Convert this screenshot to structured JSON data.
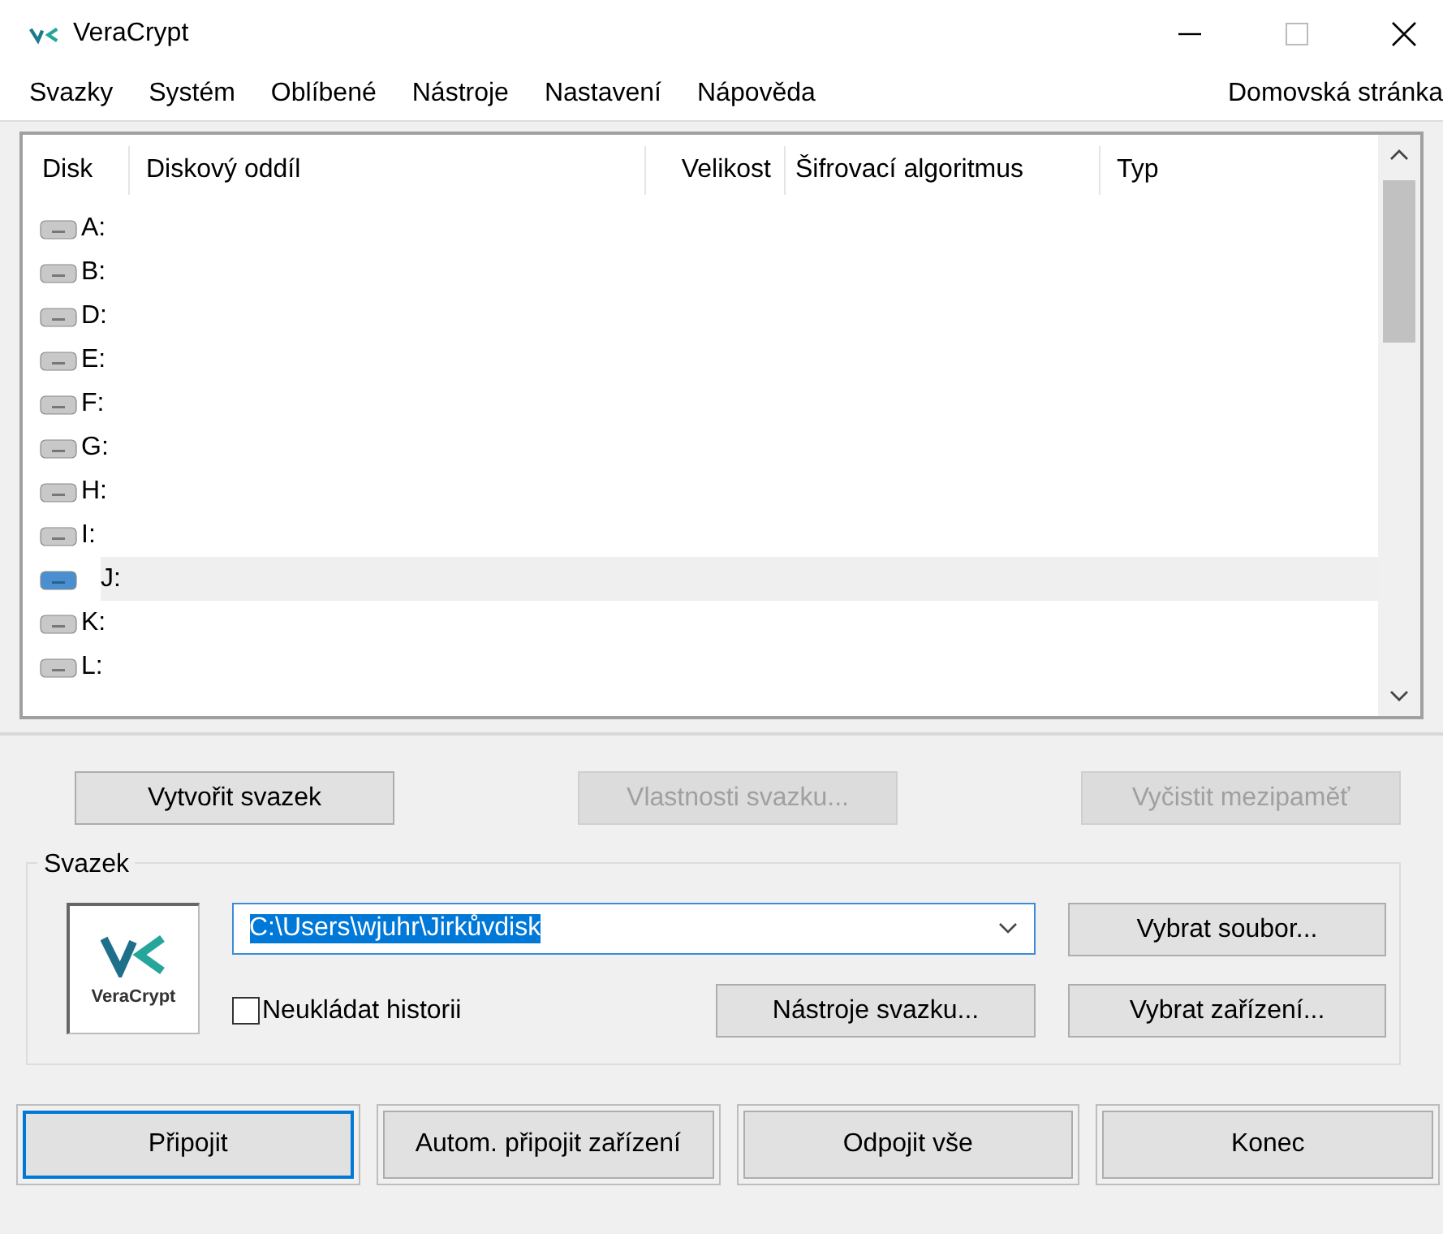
{
  "window": {
    "title": "VeraCrypt"
  },
  "menu": [
    "Svazky",
    "Systém",
    "Oblíbené",
    "Nástroje",
    "Nastavení",
    "Nápověda"
  ],
  "home_link": "Domovská stránka",
  "table": {
    "columns": [
      "Disk",
      "Diskový oddíl",
      "Velikost",
      "Šifrovací algoritmus",
      "Typ"
    ],
    "rows": [
      {
        "disk": "A:",
        "selected": false
      },
      {
        "disk": "B:",
        "selected": false
      },
      {
        "disk": "D:",
        "selected": false
      },
      {
        "disk": "E:",
        "selected": false
      },
      {
        "disk": "F:",
        "selected": false
      },
      {
        "disk": "G:",
        "selected": false
      },
      {
        "disk": "H:",
        "selected": false
      },
      {
        "disk": "I:",
        "selected": false
      },
      {
        "disk": "J:",
        "selected": true
      },
      {
        "disk": "K:",
        "selected": false
      },
      {
        "disk": "L:",
        "selected": false
      }
    ]
  },
  "top_buttons": [
    {
      "label": "Vytvořit svazek",
      "disabled": false
    },
    {
      "label": "Vlastnosti svazku...",
      "disabled": true
    },
    {
      "label": "Vyčistit mezipaměť",
      "disabled": true
    }
  ],
  "volume": {
    "label": "Svazek",
    "logo_text": "VeraCrypt",
    "path": "C:\\Users\\wjuhr\\Jirkůvdisk",
    "no_history": {
      "label": "Neukládat historii",
      "checked": false
    },
    "select_file": "Vybrat soubor...",
    "volume_tools": "Nástroje svazku...",
    "select_device": "Vybrat zařízení..."
  },
  "bottom_buttons": [
    {
      "label": "Připojit",
      "selected": true
    },
    {
      "label": "Autom. připojit zařízení",
      "selected": false
    },
    {
      "label": "Odpojit vše",
      "selected": false
    },
    {
      "label": "Konec",
      "selected": false
    }
  ]
}
